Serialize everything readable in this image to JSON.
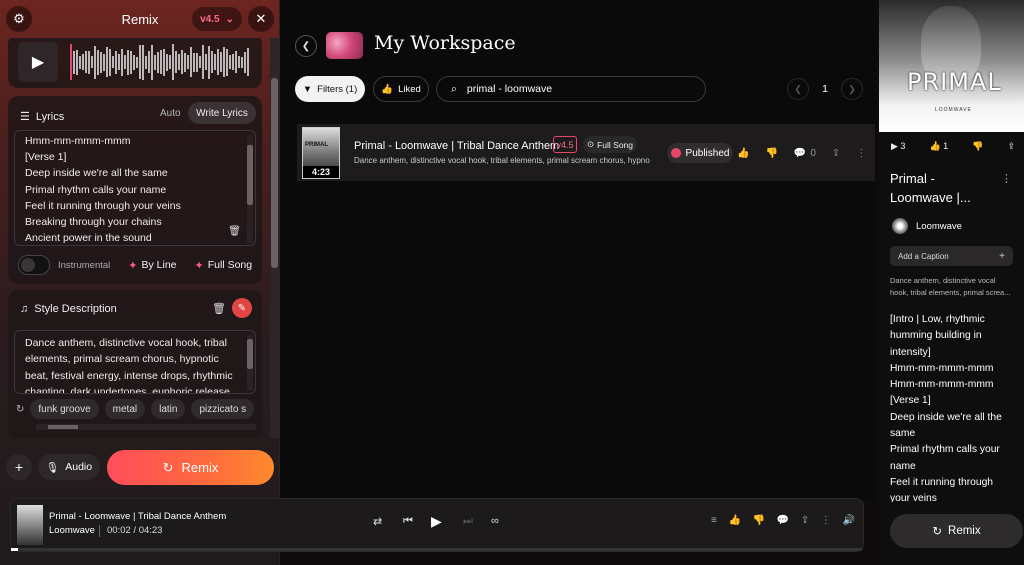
{
  "header": {
    "title": "Remix",
    "version": "v4.5",
    "version_caret": "⌄",
    "settings_icon": "gear-icon",
    "close_icon": "close-icon"
  },
  "lyrics": {
    "label": "Lyrics",
    "tab_auto": "Auto",
    "tab_write": "Write Lyrics",
    "lines": [
      "Hmm-mm-mmm-mmm",
      "[Verse 1]",
      "Deep inside we're all the same",
      "Primal rhythm calls your name",
      "Feel it running through your veins",
      "Breaking through your chains",
      "Ancient power in the sound"
    ],
    "instrumental_label": "Instrumental",
    "by_line_label": "By Line",
    "full_song_label": "Full Song"
  },
  "style": {
    "label": "Style Description",
    "text": "Dance anthem, distinctive vocal hook, tribal elements, primal scream chorus, hypnotic beat, festival energy, intense drops, rhythmic chanting, dark undertones, euphoric release",
    "chips": [
      "funk groove",
      "metal",
      "latin",
      "pizzicato s"
    ]
  },
  "footer": {
    "audio_label": "Audio",
    "remix_label": "Remix"
  },
  "workspace": {
    "title": "My Workspace",
    "filters_label": "Filters (1)",
    "liked_label": "Liked",
    "search_value": "primal - loomwave",
    "page": "1"
  },
  "song": {
    "title": "Primal - Loomwave | Tribal Dance Anthem",
    "version": "v4.5",
    "full_song": "Full Song",
    "tags": "Dance anthem, distinctive vocal hook, tribal elements, primal scream chorus, hypnoti...",
    "duration": "4:23",
    "thumb_text": "PRIMAL",
    "status": "Published",
    "comments": "0"
  },
  "player": {
    "title": "Primal - Loomwave | Tribal Dance Anthem",
    "artist": "Loomwave",
    "time": "00:02 / 04:23",
    "progress": 0.008
  },
  "right": {
    "cover_word": "PRIMAL",
    "cover_sub": "LOOMWAVE",
    "plays": "3",
    "likes": "1",
    "title": "Primal - Loomwave |...",
    "artist": "Loomwave",
    "caption_placeholder": "Add a Caption",
    "tags": "Dance anthem, distinctive vocal hook, tribal elements, primal screa...",
    "lyrics": [
      "[Intro | Low, rhythmic humming building in intensity]",
      "Hmm-mm-mmm-mmm",
      "Hmm-mm-mmm-mmm",
      "[Verse 1]",
      "Deep inside we're all the same",
      "Primal rhythm calls your name",
      "Feel it running through your veins"
    ],
    "remix_label": "Remix"
  },
  "colors": {
    "accent": "#e8466a",
    "remix_gradient_start": "#ff4d5a",
    "remix_gradient_end": "#ff8a2d"
  }
}
